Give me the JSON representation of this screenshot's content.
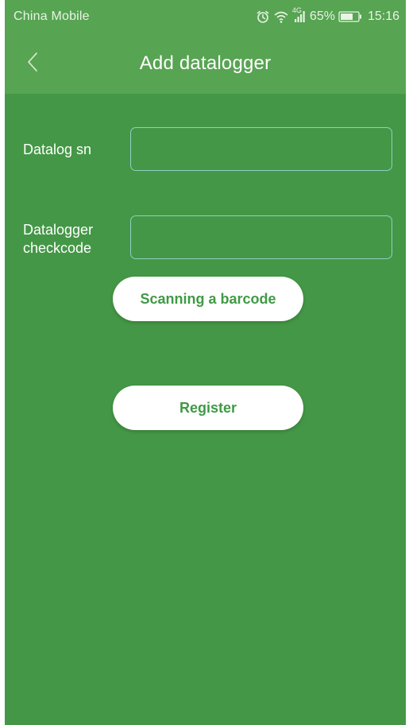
{
  "status_bar": {
    "carrier": "China Mobile",
    "network_type": "4G",
    "battery_percent": "65%",
    "time": "15:16",
    "icons": [
      "alarm-icon",
      "wifi-icon",
      "signal-icon",
      "battery-icon"
    ]
  },
  "header": {
    "title": "Add datalogger",
    "back_icon": "chevron-left-icon"
  },
  "form": {
    "sn_label": "Datalog sn",
    "sn_value": "",
    "checkcode_label_line1": "Datalogger",
    "checkcode_label_line2": "checkcode",
    "checkcode_value": ""
  },
  "actions": {
    "scan_label": "Scanning a barcode",
    "register_label": "Register"
  },
  "colors": {
    "background": "#449746",
    "header": "#57a452",
    "button_text": "#3f9a45",
    "field_border": "#8fd0c0"
  }
}
